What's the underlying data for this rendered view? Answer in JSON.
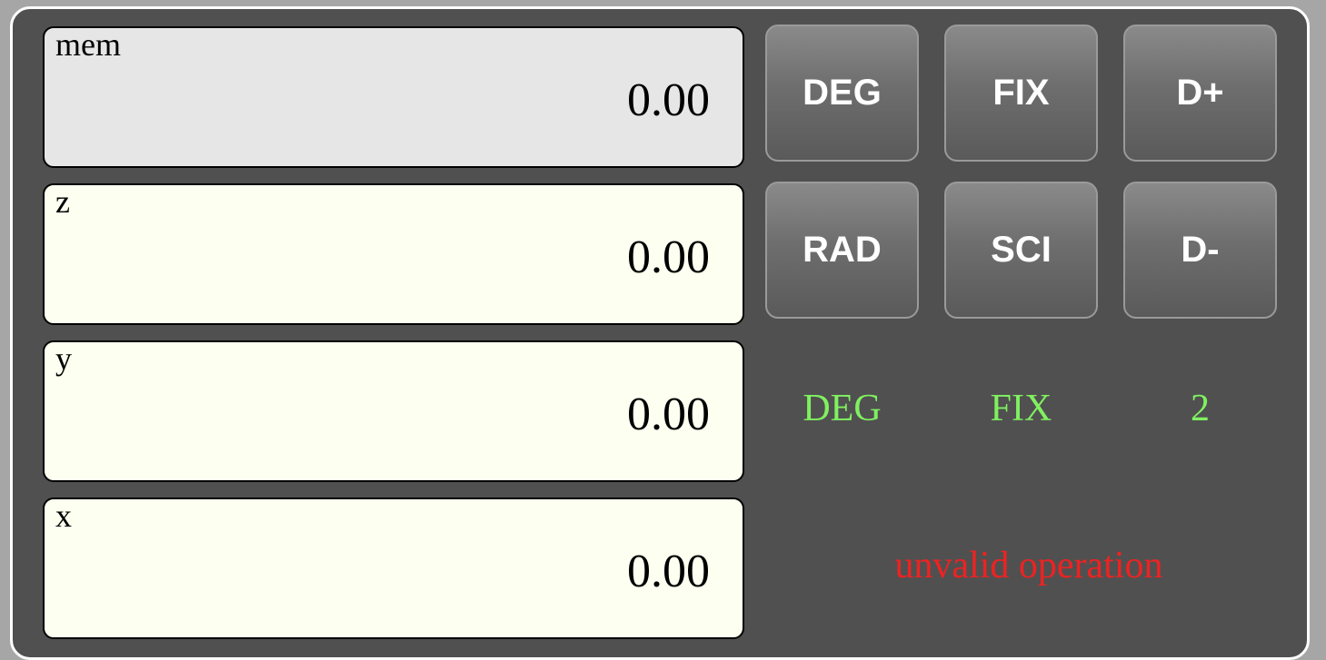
{
  "registers": [
    {
      "label": "mem",
      "value": "0.00"
    },
    {
      "label": "z",
      "value": "0.00"
    },
    {
      "label": "y",
      "value": "0.00"
    },
    {
      "label": "x",
      "value": "0.00"
    }
  ],
  "buttons": {
    "deg": "DEG",
    "fix": "FIX",
    "digits_plus": "D+",
    "rad": "RAD",
    "sci": "SCI",
    "digits_minus": "D-"
  },
  "status": {
    "angle_mode": "DEG",
    "display_mode": "FIX",
    "digits": "2"
  },
  "message": "unvalid operation",
  "colors": {
    "panel_bg": "#505050",
    "register_bg": "#fdfff0",
    "memory_bg": "#e6e6e6",
    "status_text": "#80f060",
    "error_text": "#ee2222"
  }
}
